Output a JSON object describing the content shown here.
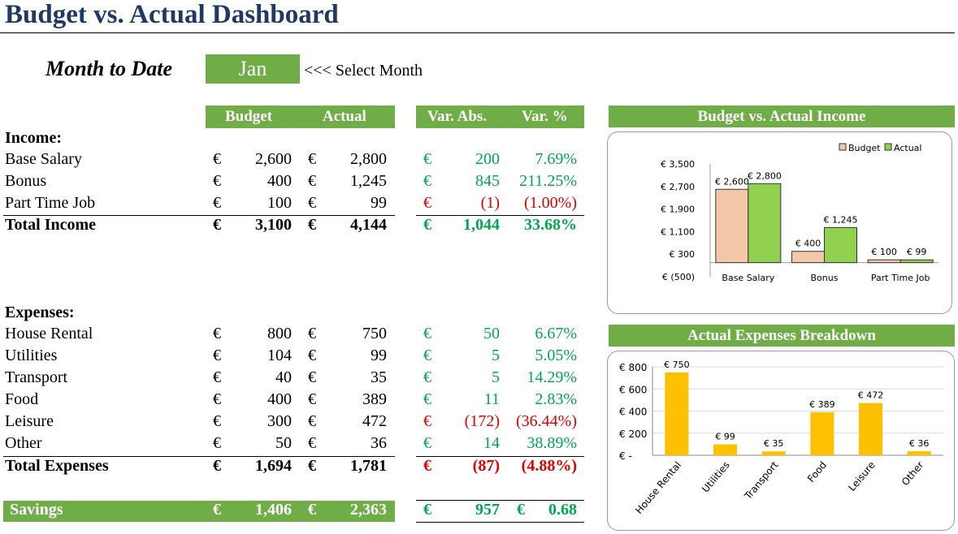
{
  "title": "Budget vs. Actual Dashboard",
  "month_label": "Month to Date",
  "selected_month": "Jan",
  "select_hint": "<<< Select Month",
  "headers": {
    "budget": "Budget",
    "actual": "Actual",
    "var_abs": "Var. Abs.",
    "var_pct": "Var. %"
  },
  "currency": "€",
  "income": {
    "heading": "Income:",
    "rows": [
      {
        "label": "Base Salary",
        "budget": "2,600",
        "actual": "2,800",
        "var_abs": "200",
        "var_pct": "7.69%",
        "status": "green"
      },
      {
        "label": "Bonus",
        "budget": "400",
        "actual": "1,245",
        "var_abs": "845",
        "var_pct": "211.25%",
        "status": "green"
      },
      {
        "label": "Part Time Job",
        "budget": "100",
        "actual": "99",
        "var_abs": "(1)",
        "var_pct": "(1.00%)",
        "status": "red"
      }
    ],
    "total": {
      "label": "Total Income",
      "budget": "3,100",
      "actual": "4,144",
      "var_abs": "1,044",
      "var_pct": "33.68%",
      "status": "green"
    }
  },
  "expenses": {
    "heading": "Expenses:",
    "rows": [
      {
        "label": "House Rental",
        "budget": "800",
        "actual": "750",
        "var_abs": "50",
        "var_pct": "6.67%",
        "status": "green"
      },
      {
        "label": "Utilities",
        "budget": "104",
        "actual": "99",
        "var_abs": "5",
        "var_pct": "5.05%",
        "status": "green"
      },
      {
        "label": "Transport",
        "budget": "40",
        "actual": "35",
        "var_abs": "5",
        "var_pct": "14.29%",
        "status": "green"
      },
      {
        "label": "Food",
        "budget": "400",
        "actual": "389",
        "var_abs": "11",
        "var_pct": "2.83%",
        "status": "green"
      },
      {
        "label": "Leisure",
        "budget": "300",
        "actual": "472",
        "var_abs": "(172)",
        "var_pct": "(36.44%)",
        "status": "red"
      },
      {
        "label": "Other",
        "budget": "50",
        "actual": "36",
        "var_abs": "14",
        "var_pct": "38.89%",
        "status": "green"
      }
    ],
    "total": {
      "label": "Total Expenses",
      "budget": "1,694",
      "actual": "1,781",
      "var_abs": "(87)",
      "var_pct": "(4.88%)",
      "status": "red"
    }
  },
  "savings": {
    "label": "Savings",
    "budget": "1,406",
    "actual": "2,363",
    "var_abs": "957",
    "var_pct": "0.68"
  },
  "colors": {
    "accent": "#70AD47",
    "green_text": "#00A651",
    "red_text": "#E00000",
    "budget_bar": "#F4C7A8",
    "actual_bar": "#92D050",
    "expense_bar": "#FFC000",
    "title_color": "#1F3864"
  },
  "chart_data": [
    {
      "type": "bar",
      "title": "Budget vs. Actual Income",
      "categories": [
        "Base Salary",
        "Bonus",
        "Part Time Job"
      ],
      "series": [
        {
          "name": "Budget",
          "values": [
            2600,
            400,
            100
          ],
          "labels": [
            "€ 2,600",
            "€ 400",
            "€ 100"
          ]
        },
        {
          "name": "Actual",
          "values": [
            2800,
            1245,
            99
          ],
          "labels": [
            "€ 2,800",
            "€ 1,245",
            "€ 99"
          ]
        }
      ],
      "yticks": [
        "€ 3,500",
        "€ 2,700",
        "€ 1,900",
        "€ 1,100",
        "€ 300",
        "€ (500)"
      ],
      "ylim": [
        -500,
        3500
      ],
      "legend": "top-right"
    },
    {
      "type": "bar",
      "title": "Actual Expenses Breakdown",
      "categories": [
        "House Rental",
        "Utilities",
        "Transport",
        "Food",
        "Leisure",
        "Other"
      ],
      "values": [
        750,
        99,
        35,
        389,
        472,
        36
      ],
      "labels": [
        "€ 750",
        "€ 99",
        "€ 35",
        "€ 389",
        "€ 472",
        "€ 36"
      ],
      "yticks": [
        "€ 800",
        "€ 600",
        "€ 400",
        "€ 200",
        "€ -"
      ],
      "ylim": [
        0,
        800
      ],
      "grid": true
    }
  ]
}
